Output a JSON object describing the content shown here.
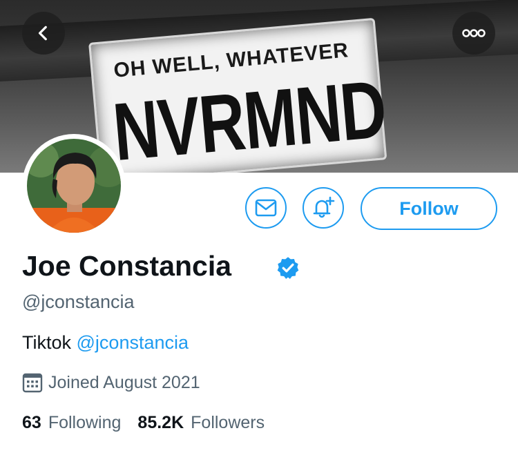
{
  "banner": {
    "plate_top_text": "OH WELL, WHATEVER",
    "plate_main_text": "NVRMND"
  },
  "header": {
    "back_icon": "chevron-left-icon",
    "more_icon": "ellipsis-icon"
  },
  "profile": {
    "name": "Joe Constancia",
    "verified": true,
    "handle": "@jconstancia",
    "bio_text": "Tiktok ",
    "bio_mention": "@jconstancia",
    "joined": "Joined August 2021"
  },
  "actions": {
    "message_icon": "envelope-icon",
    "notify_icon": "bell-plus-icon",
    "follow_label": "Follow"
  },
  "stats": {
    "following_count": "63",
    "following_label": "Following",
    "followers_count": "85.2K",
    "followers_label": "Followers"
  },
  "colors": {
    "accent": "#1d9bf0",
    "text": "#0f1419",
    "muted": "#536471"
  }
}
